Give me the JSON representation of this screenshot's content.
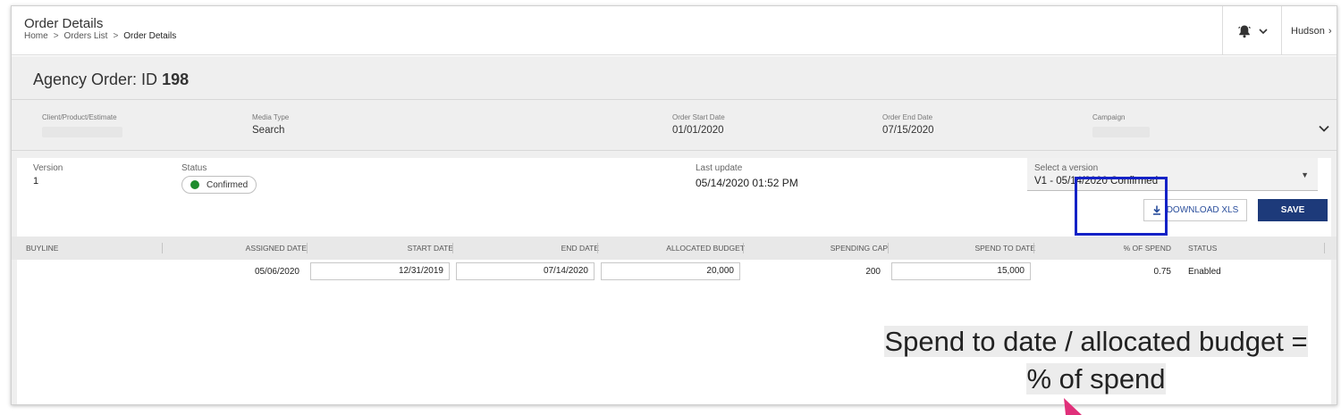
{
  "header": {
    "title": "Order Details",
    "breadcrumb": [
      "Home",
      "Orders List",
      "Order Details"
    ],
    "user_name": "Hudson"
  },
  "order": {
    "title_prefix": "Agency Order: ID",
    "id": "198"
  },
  "meta": {
    "client_label": "Client/Product/Estimate",
    "media_type_label": "Media Type",
    "media_type_value": "Search",
    "start_label": "Order Start Date",
    "start_value": "01/01/2020",
    "end_label": "Order End Date",
    "end_value": "07/15/2020",
    "campaign_label": "Campaign"
  },
  "version": {
    "version_label": "Version",
    "version_value": "1",
    "status_label": "Status",
    "status_value": "Confirmed",
    "last_update_label": "Last update",
    "last_update_value": "05/14/2020 01:52 PM",
    "select_label": "Select a version",
    "select_value": "V1 - 05/14/2020 Confirmed"
  },
  "actions": {
    "download_label": "DOWNLOAD XLS",
    "save_label": "SAVE"
  },
  "table": {
    "columns": [
      "BUYLINE",
      "ASSIGNED DATE",
      "START DATE",
      "END DATE",
      "ALLOCATED BUDGET",
      "SPENDING CAP",
      "SPEND TO DATE",
      "% OF SPEND",
      "STATUS"
    ],
    "rows": [
      {
        "buyline": "",
        "assigned_date": "05/06/2020",
        "start_date": "12/31/2019",
        "end_date": "07/14/2020",
        "allocated_budget": "20,000",
        "spending_cap": "200",
        "spend_to_date": "15,000",
        "pct_of_spend": "0.75",
        "status": "Enabled"
      }
    ]
  },
  "annotation": {
    "line1": "Spend to date / allocated budget =",
    "line2": "% of spend"
  },
  "colors": {
    "primary": "#1d3a7a",
    "highlight": "#1422c6",
    "status_green": "#1e8c2e",
    "arrow": "#e0307a"
  }
}
